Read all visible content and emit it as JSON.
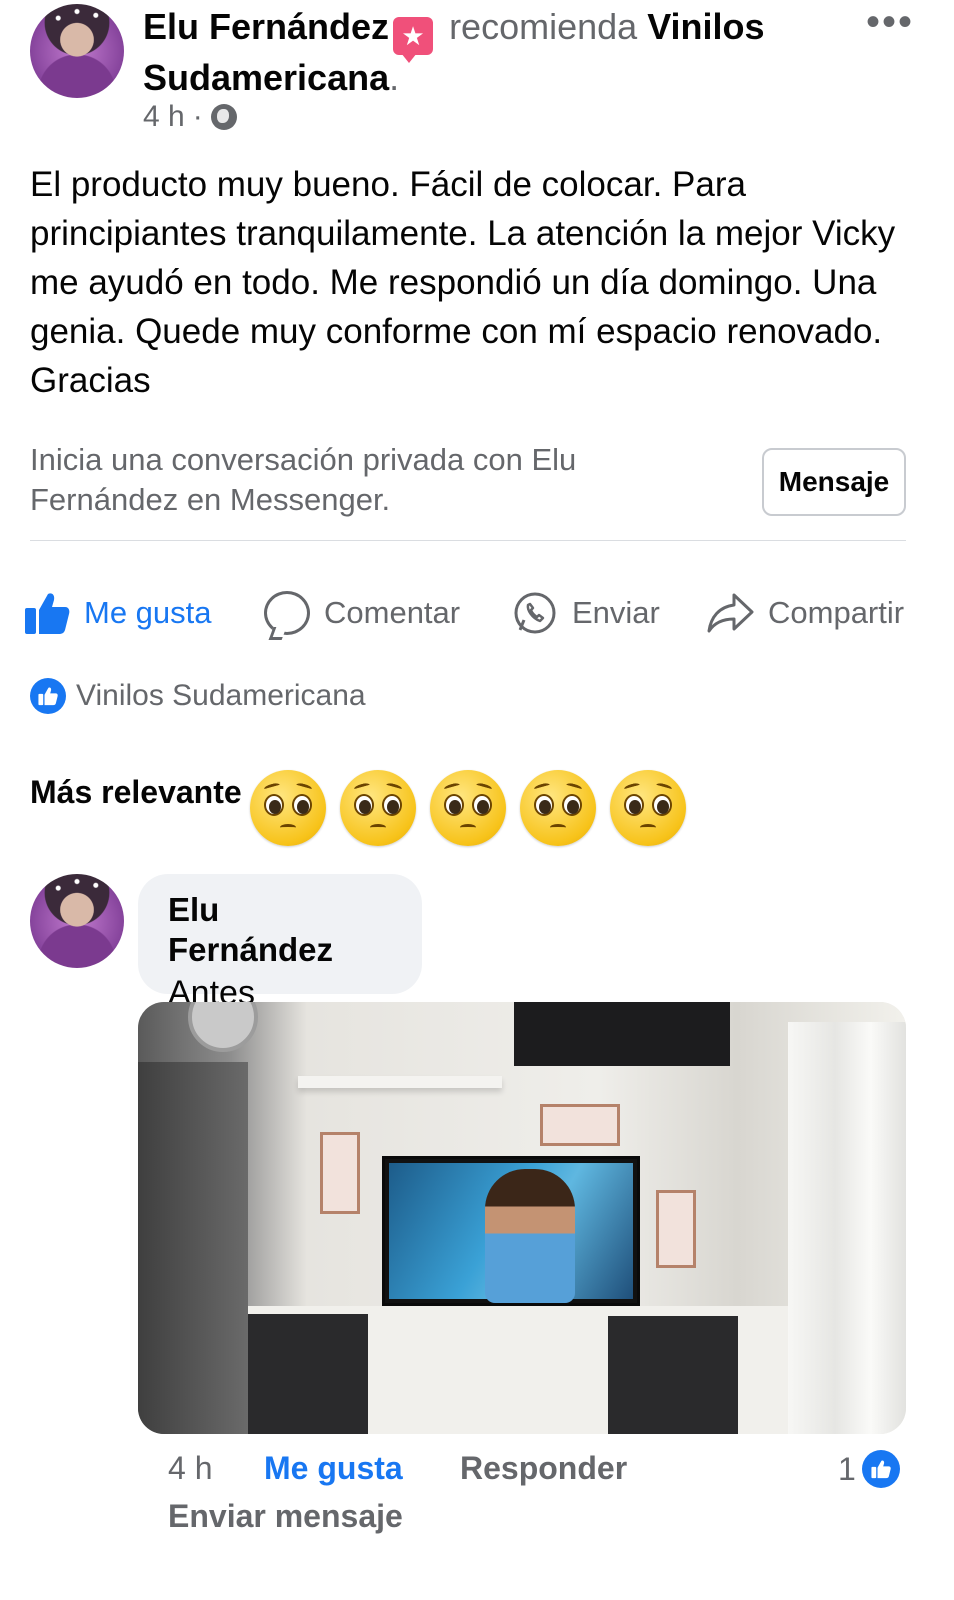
{
  "post": {
    "author": "Elu Fernández",
    "verb": "recomienda",
    "page_line1": "Vinilos",
    "page_line2": "Sudamericana",
    "period": ".",
    "time": "4 h",
    "separator": "·",
    "icons": {
      "badge": "recommend-star-icon",
      "privacy": "globe-icon",
      "menu": "more-options-icon"
    },
    "body": "El producto muy bueno. Fácil de colocar. Para principiantes tranquilamente. La atención la mejor Vicky me ayudó en todo. Me respondió un día domingo. Una genia. Quede muy conforme con mí espacio renovado. Gracias"
  },
  "messenger": {
    "prompt": "Inicia una conversación privada con Elu Fernández en Messenger.",
    "button_label": "Mensaje"
  },
  "actions": {
    "like": "Me gusta",
    "comment": "Comentar",
    "send": "Enviar",
    "share": "Compartir"
  },
  "reactions": {
    "liked_by": "Vinilos Sudamericana"
  },
  "comments_section": {
    "sort_label": "Más relevante",
    "emojis": [
      "pleading-face",
      "pleading-face",
      "pleading-face",
      "pleading-face",
      "pleading-face"
    ]
  },
  "comment": {
    "author": "Elu Fernández",
    "text": "Antes",
    "time": "4 h",
    "like_label": "Me gusta",
    "reply_label": "Responder",
    "reaction_count": "1",
    "send_message_label": "Enviar mensaje"
  },
  "colors": {
    "accent": "#1877f2",
    "muted_text": "#65676b",
    "text": "#050505",
    "bubble_bg": "#f0f2f5",
    "badge": "#f0507a"
  }
}
